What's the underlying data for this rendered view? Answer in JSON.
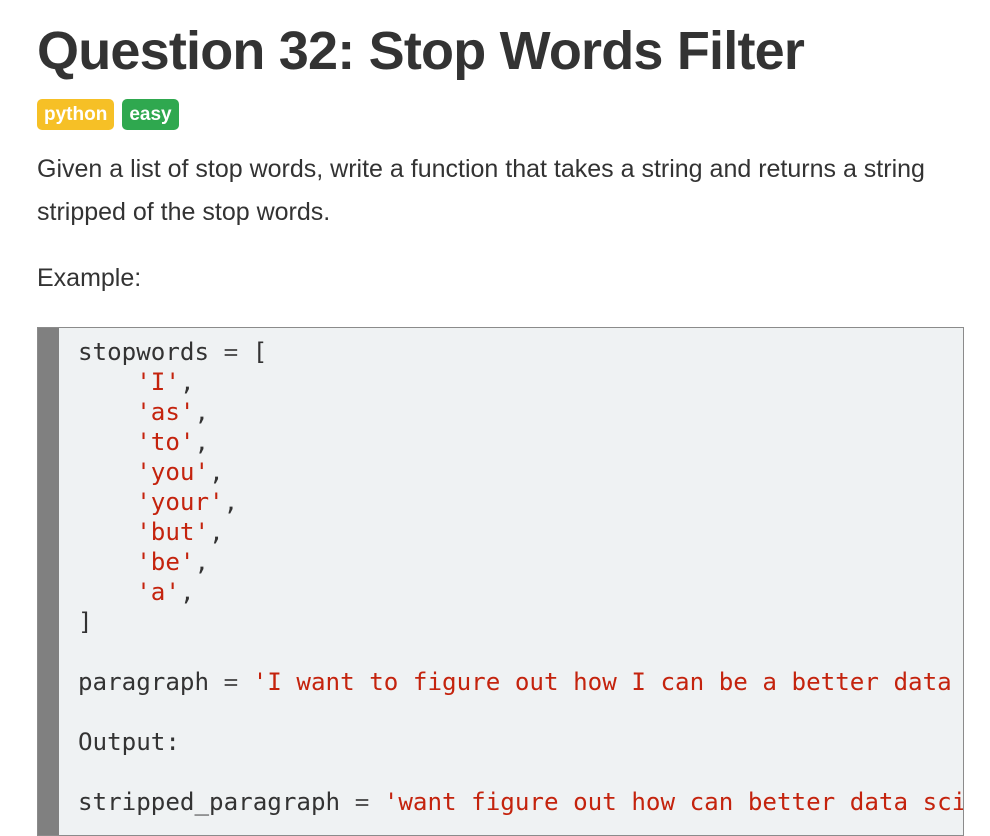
{
  "question": {
    "title": "Question 32: Stop Words Filter",
    "tags": {
      "language": "python",
      "difficulty": "easy"
    },
    "description": "Given a list of stop words, write a function that takes a string and returns a string stripped of the stop words.",
    "example_label": "Example:"
  },
  "code": {
    "stopwords_var": "stopwords",
    "equals": "=",
    "open_bracket": "[",
    "close_bracket": "]",
    "stopwords": [
      "'I'",
      "'as'",
      "'to'",
      "'you'",
      "'your'",
      "'but'",
      "'be'",
      "'a'"
    ],
    "comma": ",",
    "paragraph_var": "paragraph",
    "paragraph_value": "'I want to figure out how I can be a better data scientist'",
    "output_label": "Output:",
    "stripped_var": "stripped_paragraph",
    "stripped_value": "'want figure out how can better data scientist'"
  },
  "colors": {
    "tag_python": "#f6c026",
    "tag_easy": "#2fa84f",
    "string_literal": "#c4230d",
    "code_background": "#eff2f3",
    "code_gutter": "#808080"
  }
}
